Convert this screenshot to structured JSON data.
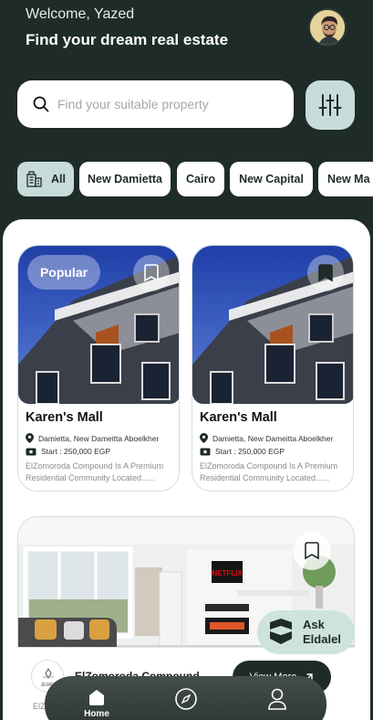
{
  "header": {
    "welcome": "Welcome, Yazed",
    "headline": "Find your dream real estate"
  },
  "search": {
    "placeholder": "Find your suitable property"
  },
  "chips": [
    {
      "label": "All",
      "active": true
    },
    {
      "label": "New Damietta"
    },
    {
      "label": "Cairo"
    },
    {
      "label": "New Capital"
    },
    {
      "label": "New Ma"
    }
  ],
  "cards": [
    {
      "badge": "Popular",
      "title": "Karen's Mall",
      "location": "Damietta, New Dameitta Aboelkher",
      "price": "Start : 250,000 EGP",
      "desc": "ElZomoroda Compound Is A Premium Residential Community Located......",
      "bookmarked": false
    },
    {
      "title": "Karen's Mall",
      "location": "Damietta, New Dameitta Aboelkher",
      "price": "Start : 250,000 EGP",
      "desc": "ElZomoroda Compound Is A Premium Residential Community Located......",
      "bookmarked": true
    }
  ],
  "featured": {
    "title": "ElZomoroda Compound",
    "view_more": "View More",
    "logo_text": "JEWEL",
    "sub": "ElZ"
  },
  "ask": {
    "line1": "Ask",
    "line2": "Eldalel"
  },
  "nav": {
    "home": "Home"
  },
  "colors": {
    "dark": "#1e2b29",
    "accent": "#c7dcd8",
    "card_border": "#cfe0dc"
  }
}
